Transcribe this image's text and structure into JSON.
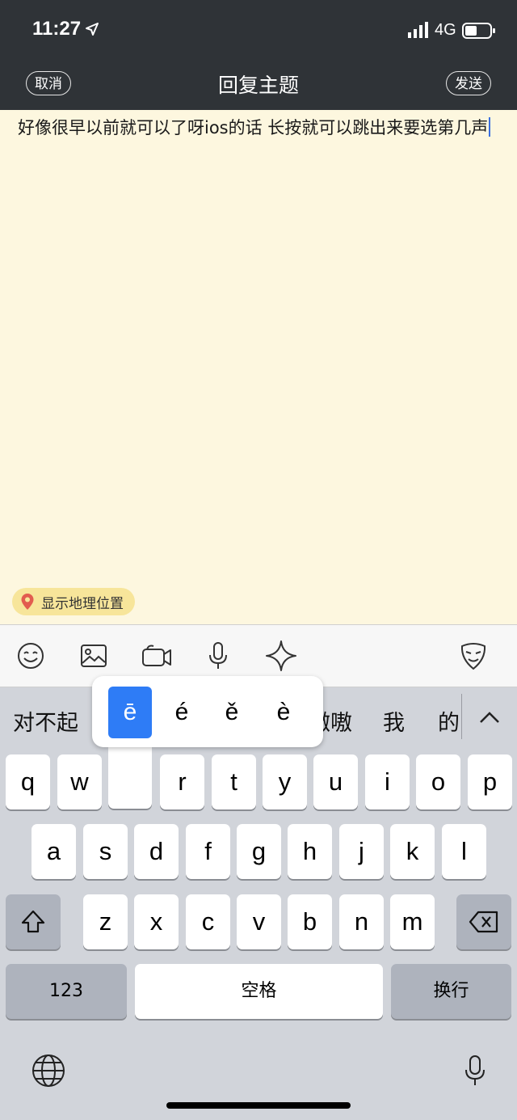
{
  "status": {
    "time": "11:27",
    "network": "4G"
  },
  "header": {
    "cancel_label": "取消",
    "title": "回复主题",
    "send_label": "发送"
  },
  "editor": {
    "text": "好像很早以前就可以了呀ios的话 长按就可以跳出来要选第几声",
    "location_label": "显示地理位置"
  },
  "toolbar": {
    "icons": [
      "smiley-icon",
      "image-icon",
      "video-icon",
      "microphone-icon",
      "sparkle-icon",
      "mask-icon"
    ]
  },
  "candidates": [
    "对不起",
    "嗷嗷",
    "我",
    "的"
  ],
  "accent_popup": [
    "ē",
    "é",
    "ě",
    "è"
  ],
  "keyboard": {
    "row1": [
      "q",
      "w",
      "e",
      "r",
      "t",
      "y",
      "u",
      "i",
      "o",
      "p"
    ],
    "row2": [
      "a",
      "s",
      "d",
      "f",
      "g",
      "h",
      "j",
      "k",
      "l"
    ],
    "row3": [
      "z",
      "x",
      "c",
      "v",
      "b",
      "n",
      "m"
    ],
    "numbers_label": "123",
    "space_label": "空格",
    "return_label": "换行"
  },
  "colors": {
    "header_bg": "#2f3337",
    "editor_bg": "#fdf7df",
    "pill_bg": "#f7e59a",
    "accent_blue": "#2e7cf6"
  }
}
